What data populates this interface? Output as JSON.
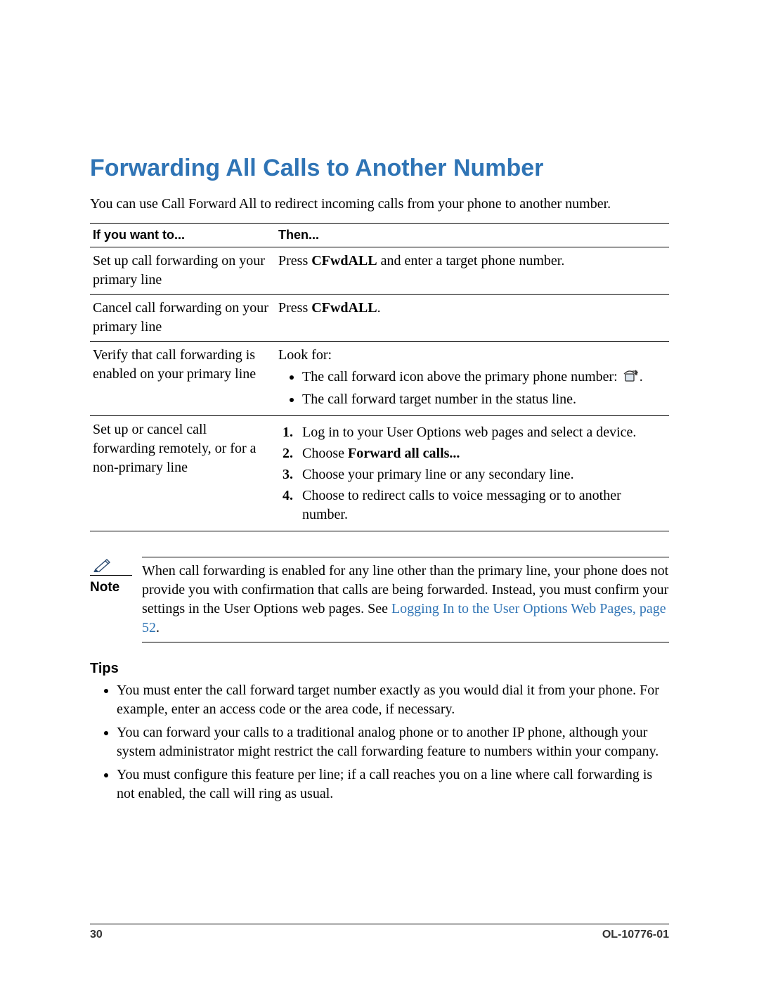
{
  "title": "Forwarding All Calls to Another Number",
  "intro": "You can use Call Forward All to redirect incoming calls from your phone to another number.",
  "table": {
    "header_if": "If you want to...",
    "header_then": "Then...",
    "rows": [
      {
        "if": "Set up call forwarding on your primary line",
        "then_prefix": "Press ",
        "then_bold": "CFwdALL",
        "then_suffix": " and enter a target phone number."
      },
      {
        "if": "Cancel call forwarding on your primary line",
        "then_prefix": "Press ",
        "then_bold": "CFwdALL",
        "then_suffix": "."
      },
      {
        "if": "Verify that call forwarding is enabled on your primary line",
        "lookfor": "Look for:",
        "bullet1_a": "The call forward icon above the primary phone number: ",
        "bullet1_b": ".",
        "bullet2": "The call forward target number in the status line."
      },
      {
        "if": "Set up or cancel call forwarding remotely, or for a non-primary line",
        "step1": "Log in to your User Options web pages and select a device.",
        "step2_a": "Choose ",
        "step2_b": "Forward all calls...",
        "step3": "Choose your primary line or any secondary line.",
        "step4": "Choose to redirect calls to voice messaging or to another number."
      }
    ]
  },
  "note": {
    "label": "Note",
    "text_a": "When call forwarding is enabled for any line other than the primary line, your phone does not provide you with confirmation that calls are being forwarded. Instead, you must confirm your settings in the User Options web pages. See ",
    "link": "Logging In to the User Options Web Pages, page 52",
    "text_b": "."
  },
  "tips": {
    "heading": "Tips",
    "items": [
      "You must enter the call forward target number exactly as you would dial it from your phone. For example, enter an access code or the area code, if necessary.",
      "You can forward your calls to a traditional analog phone or to another IP phone, although your system administrator might restrict the call forwarding feature to numbers within your company.",
      "You must configure this feature per line; if a call reaches you on a line where call forwarding is not enabled, the call will ring as usual."
    ]
  },
  "footer": {
    "page": "30",
    "doc": "OL-10776-01"
  }
}
